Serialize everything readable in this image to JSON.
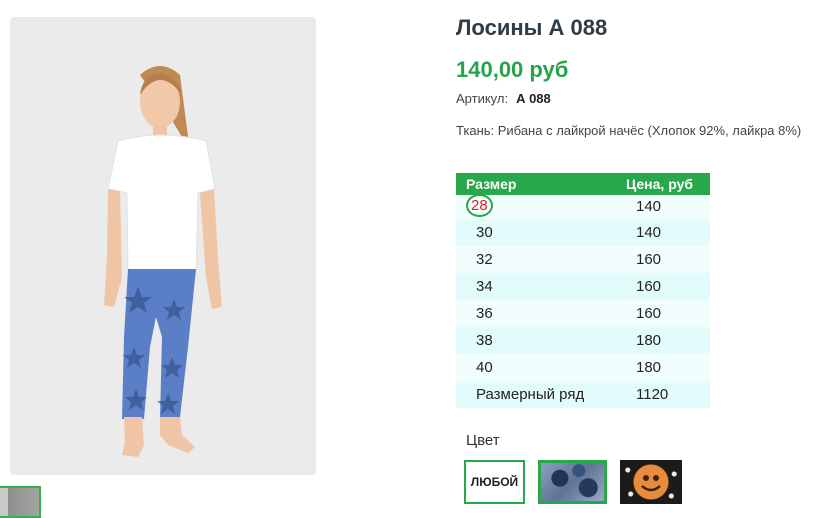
{
  "product": {
    "title": "Лосины А 088",
    "price": "140,00 руб",
    "sku_label": "Артикул:",
    "sku_value": "А 088",
    "fabric": "Ткань: Рибана с лайкрой начёс (Хлопок 92%, лайкра 8%)"
  },
  "size_table": {
    "header_size": "Размер",
    "header_price": "Цена, руб",
    "rows": [
      {
        "size": "28",
        "price": "140",
        "selected": true
      },
      {
        "size": "30",
        "price": "140"
      },
      {
        "size": "32",
        "price": "160"
      },
      {
        "size": "34",
        "price": "160"
      },
      {
        "size": "36",
        "price": "160"
      },
      {
        "size": "38",
        "price": "180"
      },
      {
        "size": "40",
        "price": "180"
      },
      {
        "size": "Размерный ряд",
        "price": "1120"
      }
    ]
  },
  "colors": {
    "label": "Цвет",
    "any_label": "ЛЮБОЙ",
    "options": [
      "any",
      "blue-stars",
      "smiley"
    ],
    "selected": "blue-stars"
  },
  "theme": {
    "accent": "#27a84a",
    "price_color": "#25a54a",
    "selected_size_color": "#e0242a"
  }
}
